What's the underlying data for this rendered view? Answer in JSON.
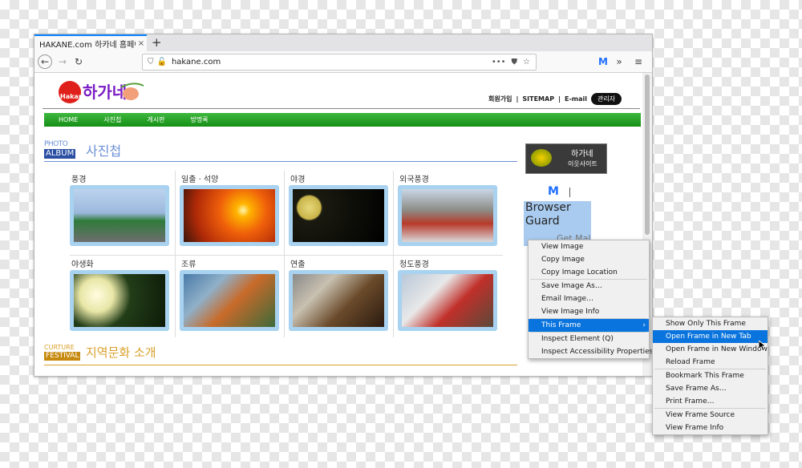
{
  "tab": {
    "title": "HAKANE.com 하카네 홈페이지",
    "close": "×",
    "new": "+"
  },
  "nav": {
    "back": "←",
    "forward": "→",
    "reload": "↻",
    "url": "hakane.com",
    "more": "•••",
    "overflow": "»",
    "menu": "≡"
  },
  "site": {
    "logo_text": "하가네",
    "logo_sub": "Hakane",
    "toplinks": [
      "회원가입",
      "SITEMAP",
      "E-mail"
    ],
    "separator": "|",
    "admin": "관리자",
    "menu": [
      "HOME",
      "사진첩",
      "게시판",
      "방명록"
    ],
    "section1": {
      "en_top": "PHOTO",
      "en_bottom": "ALBUM",
      "ko": "사진첩"
    },
    "section2": {
      "en_top": "CURTURE",
      "en_bottom": "FESTIVAL",
      "ko": "지역문화 소개"
    },
    "gallery": [
      "풍경",
      "일출 · 석양",
      "야경",
      "외국풍경",
      "야생화",
      "조류",
      "연출",
      "청도풍경"
    ],
    "ad": {
      "title": "하가네",
      "sub": "이웃사이트"
    },
    "malwarebytes": {
      "icon": "M",
      "title_line1": "Browser",
      "title_line2": "Guard",
      "cta": "Get Mal"
    }
  },
  "context_menu": {
    "items": [
      "View Image",
      "Copy Image",
      "Copy Image Location",
      "Save Image As…",
      "Email Image…",
      "View Image Info",
      "This Frame",
      "Inspect Element (Q)",
      "Inspect Accessibility Properties"
    ],
    "selected": "This Frame",
    "submenu_arrow": "›"
  },
  "submenu": {
    "items": [
      "Show Only This Frame",
      "Open Frame in New Tab",
      "Open Frame in New Window",
      "Reload Frame",
      "Bookmark This Frame",
      "Save Frame As…",
      "Print Frame…",
      "View Frame Source",
      "View Frame Info"
    ],
    "selected": "Open Frame in New Tab"
  },
  "colors": {
    "accent": "#0a74de",
    "menubar": "#1f9f1f",
    "frame_blue": "#a8d2ef",
    "section_blue": "#6b8fd6",
    "section_orange": "#d9a02a"
  }
}
